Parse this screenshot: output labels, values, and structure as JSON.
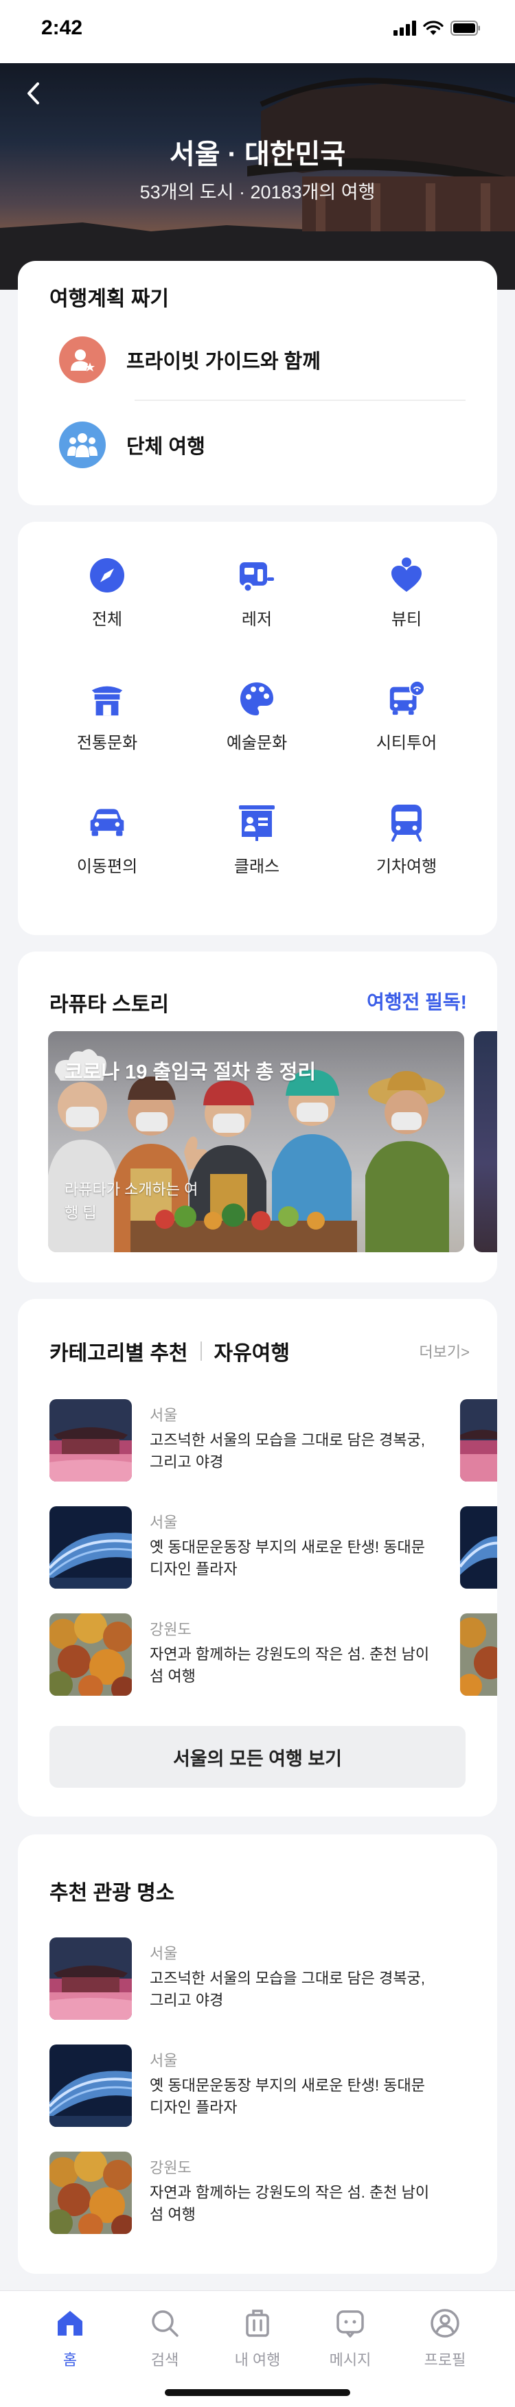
{
  "status_bar": {
    "time": "2:42",
    "icons": [
      "signal-icon",
      "wifi-icon",
      "battery-icon"
    ]
  },
  "hero": {
    "title": "서울 · 대한민국",
    "subtitle": "53개의 도시 · 20183개의 여행",
    "back_icon": "chevron-left-icon"
  },
  "plan": {
    "title": "여행계획 짜기",
    "options": [
      {
        "label": "프라이빗 가이드와 함께",
        "icon": "private-guide-icon",
        "color": "#e57d6b"
      },
      {
        "label": "단체 여행",
        "icon": "group-icon",
        "color": "#5a9fe6"
      }
    ]
  },
  "categories": {
    "accent": "#3b5ee8",
    "items": [
      {
        "label": "전체",
        "icon": "compass-icon"
      },
      {
        "label": "레저",
        "icon": "camper-icon"
      },
      {
        "label": "뷰티",
        "icon": "beauty-icon"
      },
      {
        "label": "전통문화",
        "icon": "temple-icon"
      },
      {
        "label": "예술문화",
        "icon": "palette-icon"
      },
      {
        "label": "시티투어",
        "icon": "city-bus-icon"
      },
      {
        "label": "이동편의",
        "icon": "car-icon"
      },
      {
        "label": "클래스",
        "icon": "class-board-icon"
      },
      {
        "label": "기차여행",
        "icon": "train-icon"
      }
    ]
  },
  "story": {
    "title": "라퓨타 스토리",
    "link": "여행전 필독!",
    "banner_title": "코로나 19 출입국 절차 총 정리",
    "banner_sub": "라퓨타가 소개하는 여행 팁"
  },
  "recommend": {
    "title": "카테고리별 추천",
    "tab": "자유여행",
    "more": "더보기>",
    "items": [
      {
        "region": "서울",
        "desc": "고즈넉한 서울의 모습을 그대로 담은 경복궁, 그리고 야경",
        "thumb": "palace-night"
      },
      {
        "region": "서울",
        "desc": "옛 동대문운동장 부지의 새로운 탄생! 동대문 디자인 플라자",
        "thumb": "ddp-night"
      },
      {
        "region": "강원도",
        "desc": "자연과 함께하는 강원도의 작은 섬. 춘천 남이섬 여행",
        "thumb": "nami-autumn"
      }
    ],
    "all_button": "서울의 모든 여행 보기"
  },
  "attractions": {
    "title": "추천 관광 명소",
    "items": [
      {
        "region": "서울",
        "desc": "고즈넉한 서울의 모습을 그대로 담은 경복궁, 그리고 야경",
        "thumb": "palace-night"
      },
      {
        "region": "서울",
        "desc": "옛 동대문운동장 부지의 새로운 탄생! 동대문 디자인 플라자",
        "thumb": "ddp-night"
      },
      {
        "region": "강원도",
        "desc": "자연과 함께하는 강원도의 작은 섬. 춘천 남이섬 여행",
        "thumb": "nami-autumn"
      }
    ]
  },
  "tabbar": {
    "active_color": "#3b5ee8",
    "tabs": [
      {
        "label": "홈",
        "icon": "home-icon",
        "active": true
      },
      {
        "label": "검색",
        "icon": "search-icon",
        "active": false
      },
      {
        "label": "내 여행",
        "icon": "suitcase-icon",
        "active": false
      },
      {
        "label": "메시지",
        "icon": "message-icon",
        "active": false
      },
      {
        "label": "프로필",
        "icon": "profile-icon",
        "active": false
      }
    ]
  }
}
